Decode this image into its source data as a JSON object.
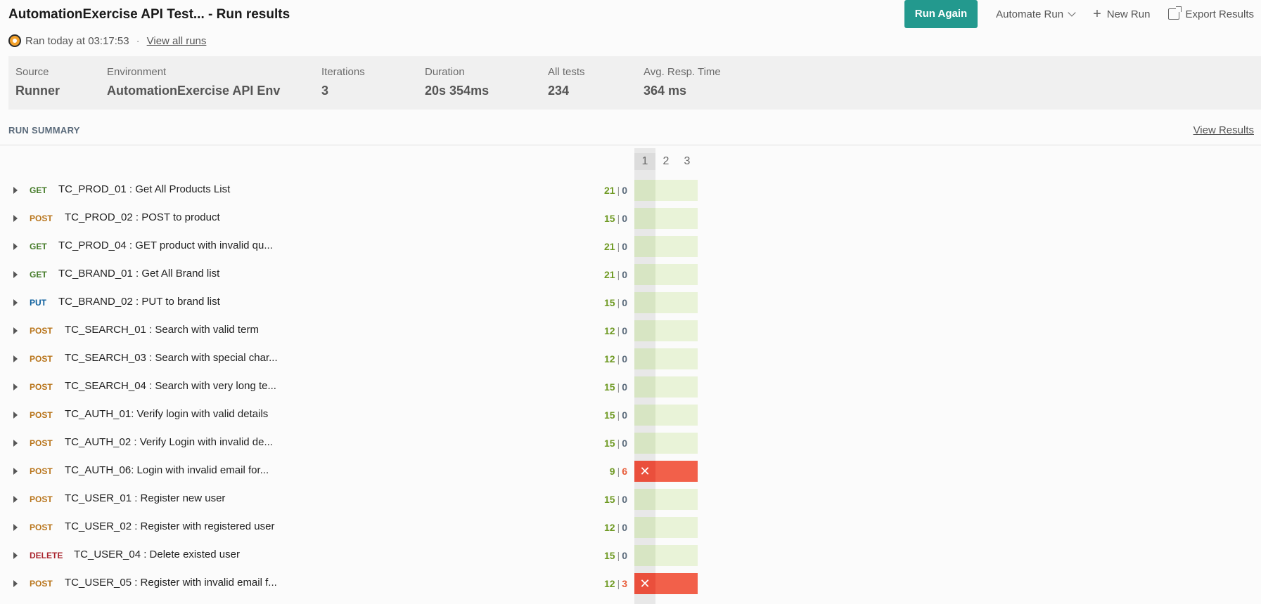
{
  "header": {
    "title": "AutomationExercise API Test... - Run results",
    "ran_text": "Ran today at 03:17:53",
    "dot": "·",
    "view_all_runs": "View all runs"
  },
  "toolbar": {
    "run_again": "Run Again",
    "automate_run": "Automate Run",
    "new_run": "New Run",
    "export_results": "Export Results"
  },
  "stats": [
    {
      "label": "Source",
      "value": "Runner"
    },
    {
      "label": "Environment",
      "value": "AutomationExercise API Env"
    },
    {
      "label": "Iterations",
      "value": "3"
    },
    {
      "label": "Duration",
      "value": "20s 354ms"
    },
    {
      "label": "All tests",
      "value": "234"
    },
    {
      "label": "Avg. Resp. Time",
      "value": "364 ms"
    }
  ],
  "summary": {
    "title": "RUN SUMMARY",
    "view_results": "View Results",
    "iterations": [
      "1",
      "2",
      "3"
    ]
  },
  "requests": [
    {
      "method": "GET",
      "name": "TC_PROD_01 : Get All Products List",
      "passed": "21",
      "failed": "0"
    },
    {
      "method": "POST",
      "name": "TC_PROD_02 : POST to product",
      "passed": "15",
      "failed": "0"
    },
    {
      "method": "GET",
      "name": "TC_PROD_04 : GET product with invalid qu...",
      "passed": "21",
      "failed": "0"
    },
    {
      "method": "GET",
      "name": "TC_BRAND_01 : Get All Brand list",
      "passed": "21",
      "failed": "0"
    },
    {
      "method": "PUT",
      "name": "TC_BRAND_02 : PUT to brand list",
      "passed": "15",
      "failed": "0"
    },
    {
      "method": "POST",
      "name": "TC_SEARCH_01 : Search with valid term",
      "passed": "12",
      "failed": "0"
    },
    {
      "method": "POST",
      "name": "TC_SEARCH_03 : Search with special char...",
      "passed": "12",
      "failed": "0"
    },
    {
      "method": "POST",
      "name": "TC_SEARCH_04 : Search with very long te...",
      "passed": "15",
      "failed": "0"
    },
    {
      "method": "POST",
      "name": "TC_AUTH_01: Verify login with valid details",
      "passed": "15",
      "failed": "0"
    },
    {
      "method": "POST",
      "name": "TC_AUTH_02 : Verify Login with invalid de...",
      "passed": "15",
      "failed": "0"
    },
    {
      "method": "POST",
      "name": "TC_AUTH_06: Login with invalid email for...",
      "passed": "9",
      "failed": "6"
    },
    {
      "method": "POST",
      "name": "TC_USER_01 : Register new user",
      "passed": "15",
      "failed": "0"
    },
    {
      "method": "POST",
      "name": "TC_USER_02 : Register with registered user",
      "passed": "12",
      "failed": "0"
    },
    {
      "method": "DELETE",
      "name": "TC_USER_04 : Delete existed user",
      "passed": "15",
      "failed": "0"
    },
    {
      "method": "POST",
      "name": "TC_USER_05 : Register with invalid email f...",
      "passed": "12",
      "failed": "3"
    }
  ],
  "fail_mark": "✕",
  "separator": "|"
}
